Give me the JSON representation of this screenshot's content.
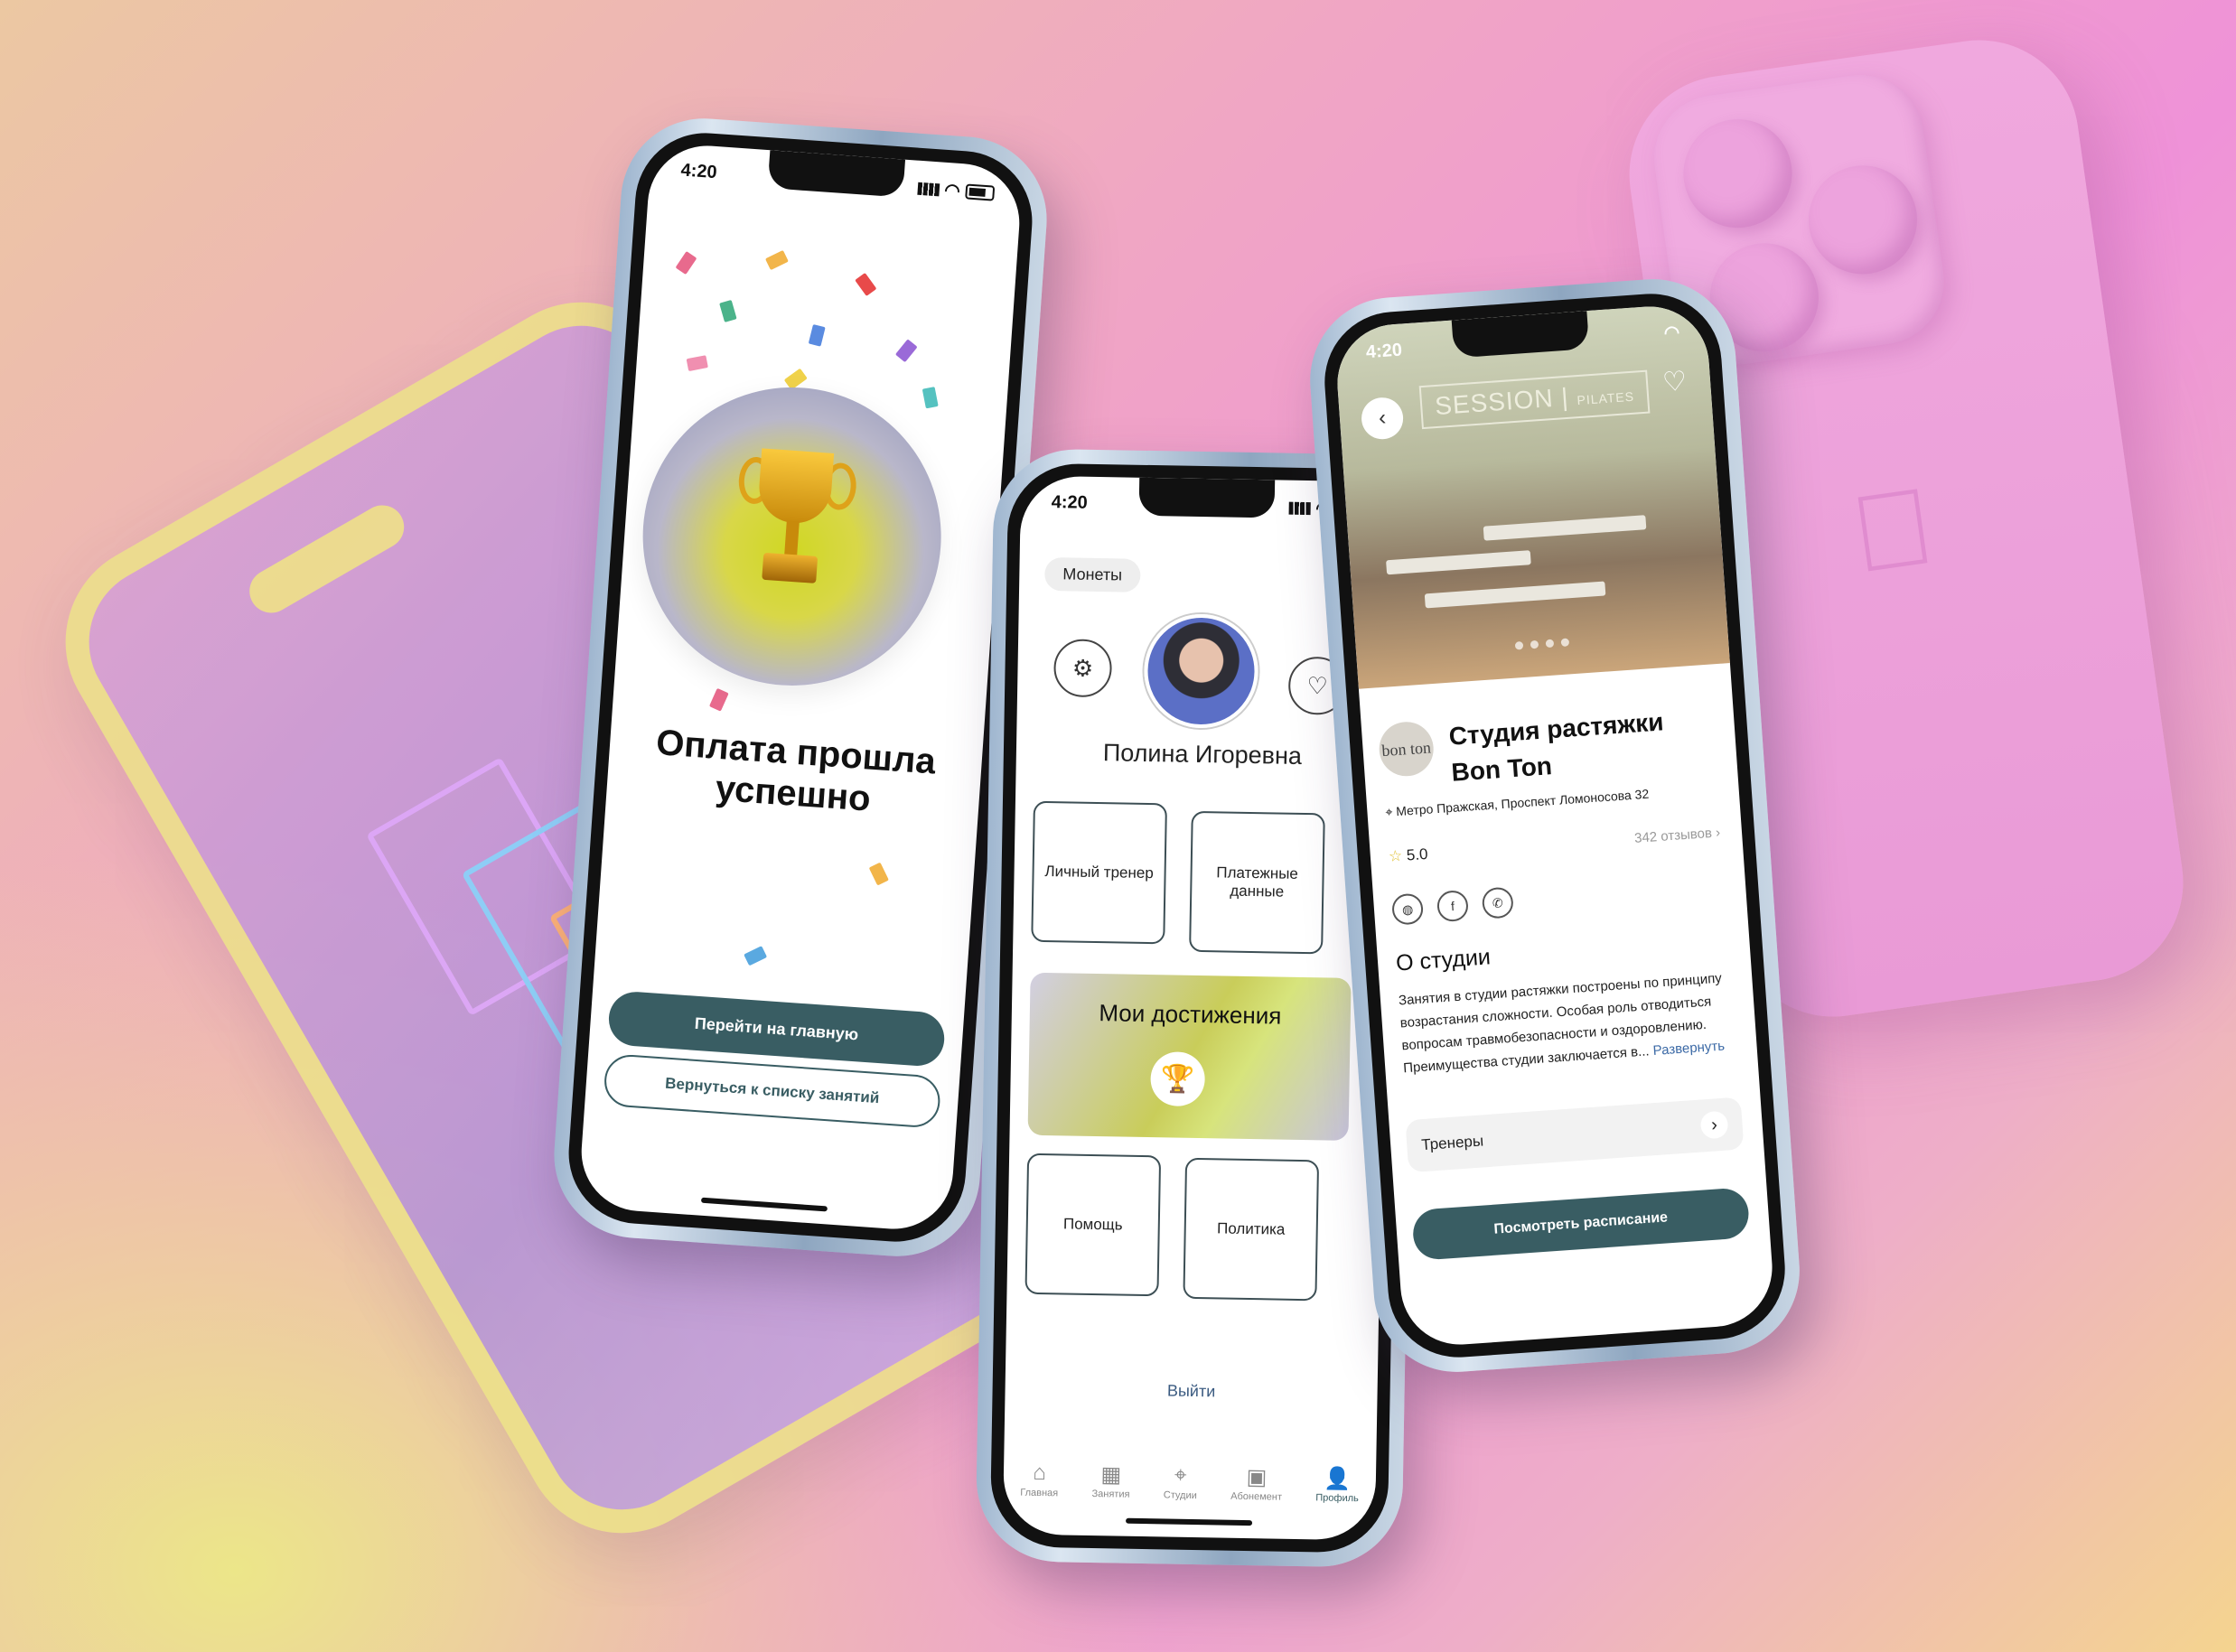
{
  "phone_payment": {
    "status_time": "4:20",
    "title": "Оплата прошла успешно",
    "primary_button": "Перейти на главную",
    "secondary_button": "Вернуться к списку занятий"
  },
  "phone_profile": {
    "status_time": "4:20",
    "coins_label": "Монеты",
    "user_name": "Полина Игоревна",
    "tiles": [
      "Личный тренер",
      "Платежные данные",
      "Помощь",
      "Политика"
    ],
    "achievements_title": "Мои достижения",
    "logout": "Выйти",
    "tabs": [
      "Главная",
      "Занятия",
      "Студии",
      "Абонемент",
      "Профиль"
    ]
  },
  "phone_studio": {
    "status_time": "4:20",
    "hero_sign": "SESSION",
    "hero_sign_small": "PILATES",
    "logo_text": "bon ton",
    "studio_name": "Студия растяжки Bon Ton",
    "address": "Метро Пражская, Проспект Ломоносова 32",
    "rating": "5.0",
    "reviews": "342 отзывов",
    "about_heading": "О студии",
    "about_text": "Занятия в студии растяжки построены по принципу возрастания сложности. Особая роль отводиться вопросам травмобезопасности и оздоровлению. Преимущества студии заключается в...",
    "about_more": "Развернуть",
    "trainers_label": "Тренеры",
    "schedule_button": "Посмотреть расписание"
  },
  "colors": {
    "accent": "#395d63",
    "link": "#3c6aa6",
    "background_pink": "#ef92d8",
    "background_yellow": "#ece689"
  }
}
